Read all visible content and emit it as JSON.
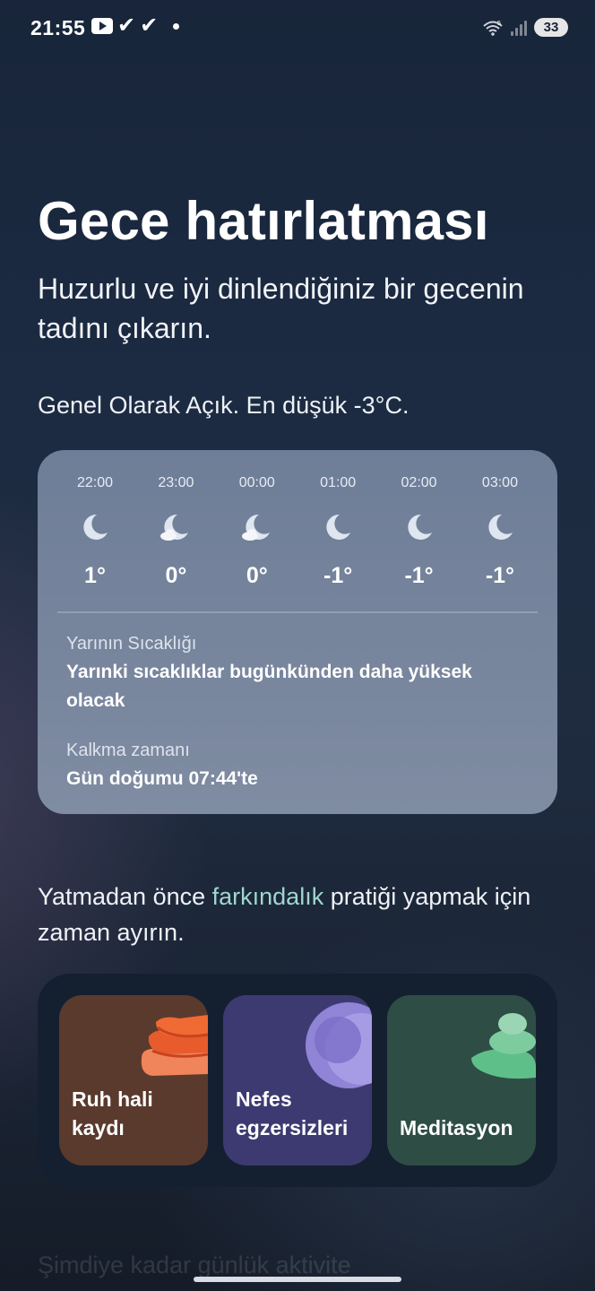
{
  "status_bar": {
    "time": "21:55",
    "battery": "33"
  },
  "header": {
    "title": "Gece hatırlatması",
    "subtitle": "Huzurlu ve iyi dinlendiğiniz bir gecenin tadını çıkarın.",
    "forecast": "Genel Olarak Açık. En düşük -3°C."
  },
  "weather": {
    "hours": [
      {
        "time": "22:00",
        "icon": "moon-icon",
        "temp": "1°"
      },
      {
        "time": "23:00",
        "icon": "moon-cloud-icon",
        "temp": "0°"
      },
      {
        "time": "00:00",
        "icon": "moon-cloud-icon",
        "temp": "0°"
      },
      {
        "time": "01:00",
        "icon": "moon-icon",
        "temp": "-1°"
      },
      {
        "time": "02:00",
        "icon": "moon-icon",
        "temp": "-1°"
      },
      {
        "time": "03:00",
        "icon": "moon-icon",
        "temp": "-1°"
      }
    ],
    "tomorrow_label": "Yarının Sıcaklığı",
    "tomorrow_value": "Yarınki sıcaklıklar bugünkünden daha yüksek olacak",
    "wake_label": "Kalkma zamanı",
    "wake_value": "Gün doğumu 07:44'te"
  },
  "mindfulness": {
    "text_before": "Yatmadan önce ",
    "highlight": "farkındalık",
    "text_after": " pratiği yapmak için zaman ayırın.",
    "highlight_color": "#9fd6cf"
  },
  "activities": [
    {
      "label": "Ruh hali kaydı",
      "color": "#5a3a2d"
    },
    {
      "label": "Nefes egzersizleri",
      "color": "#3d3a72"
    },
    {
      "label": "Meditasyon",
      "color": "#2e4e45"
    }
  ],
  "footer_partial": "Şimdiye kadar günlük aktivite"
}
